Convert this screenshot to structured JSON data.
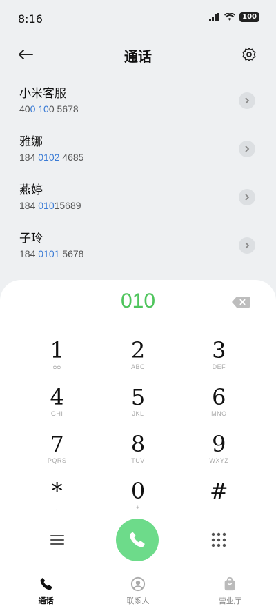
{
  "status": {
    "time": "8:16",
    "battery": "100"
  },
  "header": {
    "title": "通话"
  },
  "contacts": [
    {
      "name": "小米客服",
      "num_pre": "40",
      "num_hl": "0 10",
      "num_post": "0 5678"
    },
    {
      "name": "雅娜",
      "num_pre": "184 ",
      "num_hl": "0102",
      "num_post": " 4685"
    },
    {
      "name": "燕婷",
      "num_pre": "184 ",
      "num_hl": "010",
      "num_post": "15689"
    },
    {
      "name": "子玲",
      "num_pre": "184 ",
      "num_hl": "0101",
      "num_post": " 5678"
    }
  ],
  "dialer": {
    "input": "010",
    "keys": [
      {
        "digit": "1",
        "letters": "ᴑᴑ"
      },
      {
        "digit": "2",
        "letters": "ABC"
      },
      {
        "digit": "3",
        "letters": "DEF"
      },
      {
        "digit": "4",
        "letters": "GHI"
      },
      {
        "digit": "5",
        "letters": "JKL"
      },
      {
        "digit": "6",
        "letters": "MNO"
      },
      {
        "digit": "7",
        "letters": "PQRS"
      },
      {
        "digit": "8",
        "letters": "TUV"
      },
      {
        "digit": "9",
        "letters": "WXYZ"
      },
      {
        "digit": "*",
        "letters": ","
      },
      {
        "digit": "0",
        "letters": "+"
      },
      {
        "digit": "#",
        "letters": ""
      }
    ]
  },
  "nav": [
    {
      "label": "通话",
      "icon": "phone-icon",
      "active": true
    },
    {
      "label": "联系人",
      "icon": "person-icon",
      "active": false
    },
    {
      "label": "营业厅",
      "icon": "bag-icon",
      "active": false
    }
  ],
  "colors": {
    "accent_green": "#4fc55d",
    "call_button": "#6ddb8a",
    "number_highlight": "#3a7bd5"
  }
}
